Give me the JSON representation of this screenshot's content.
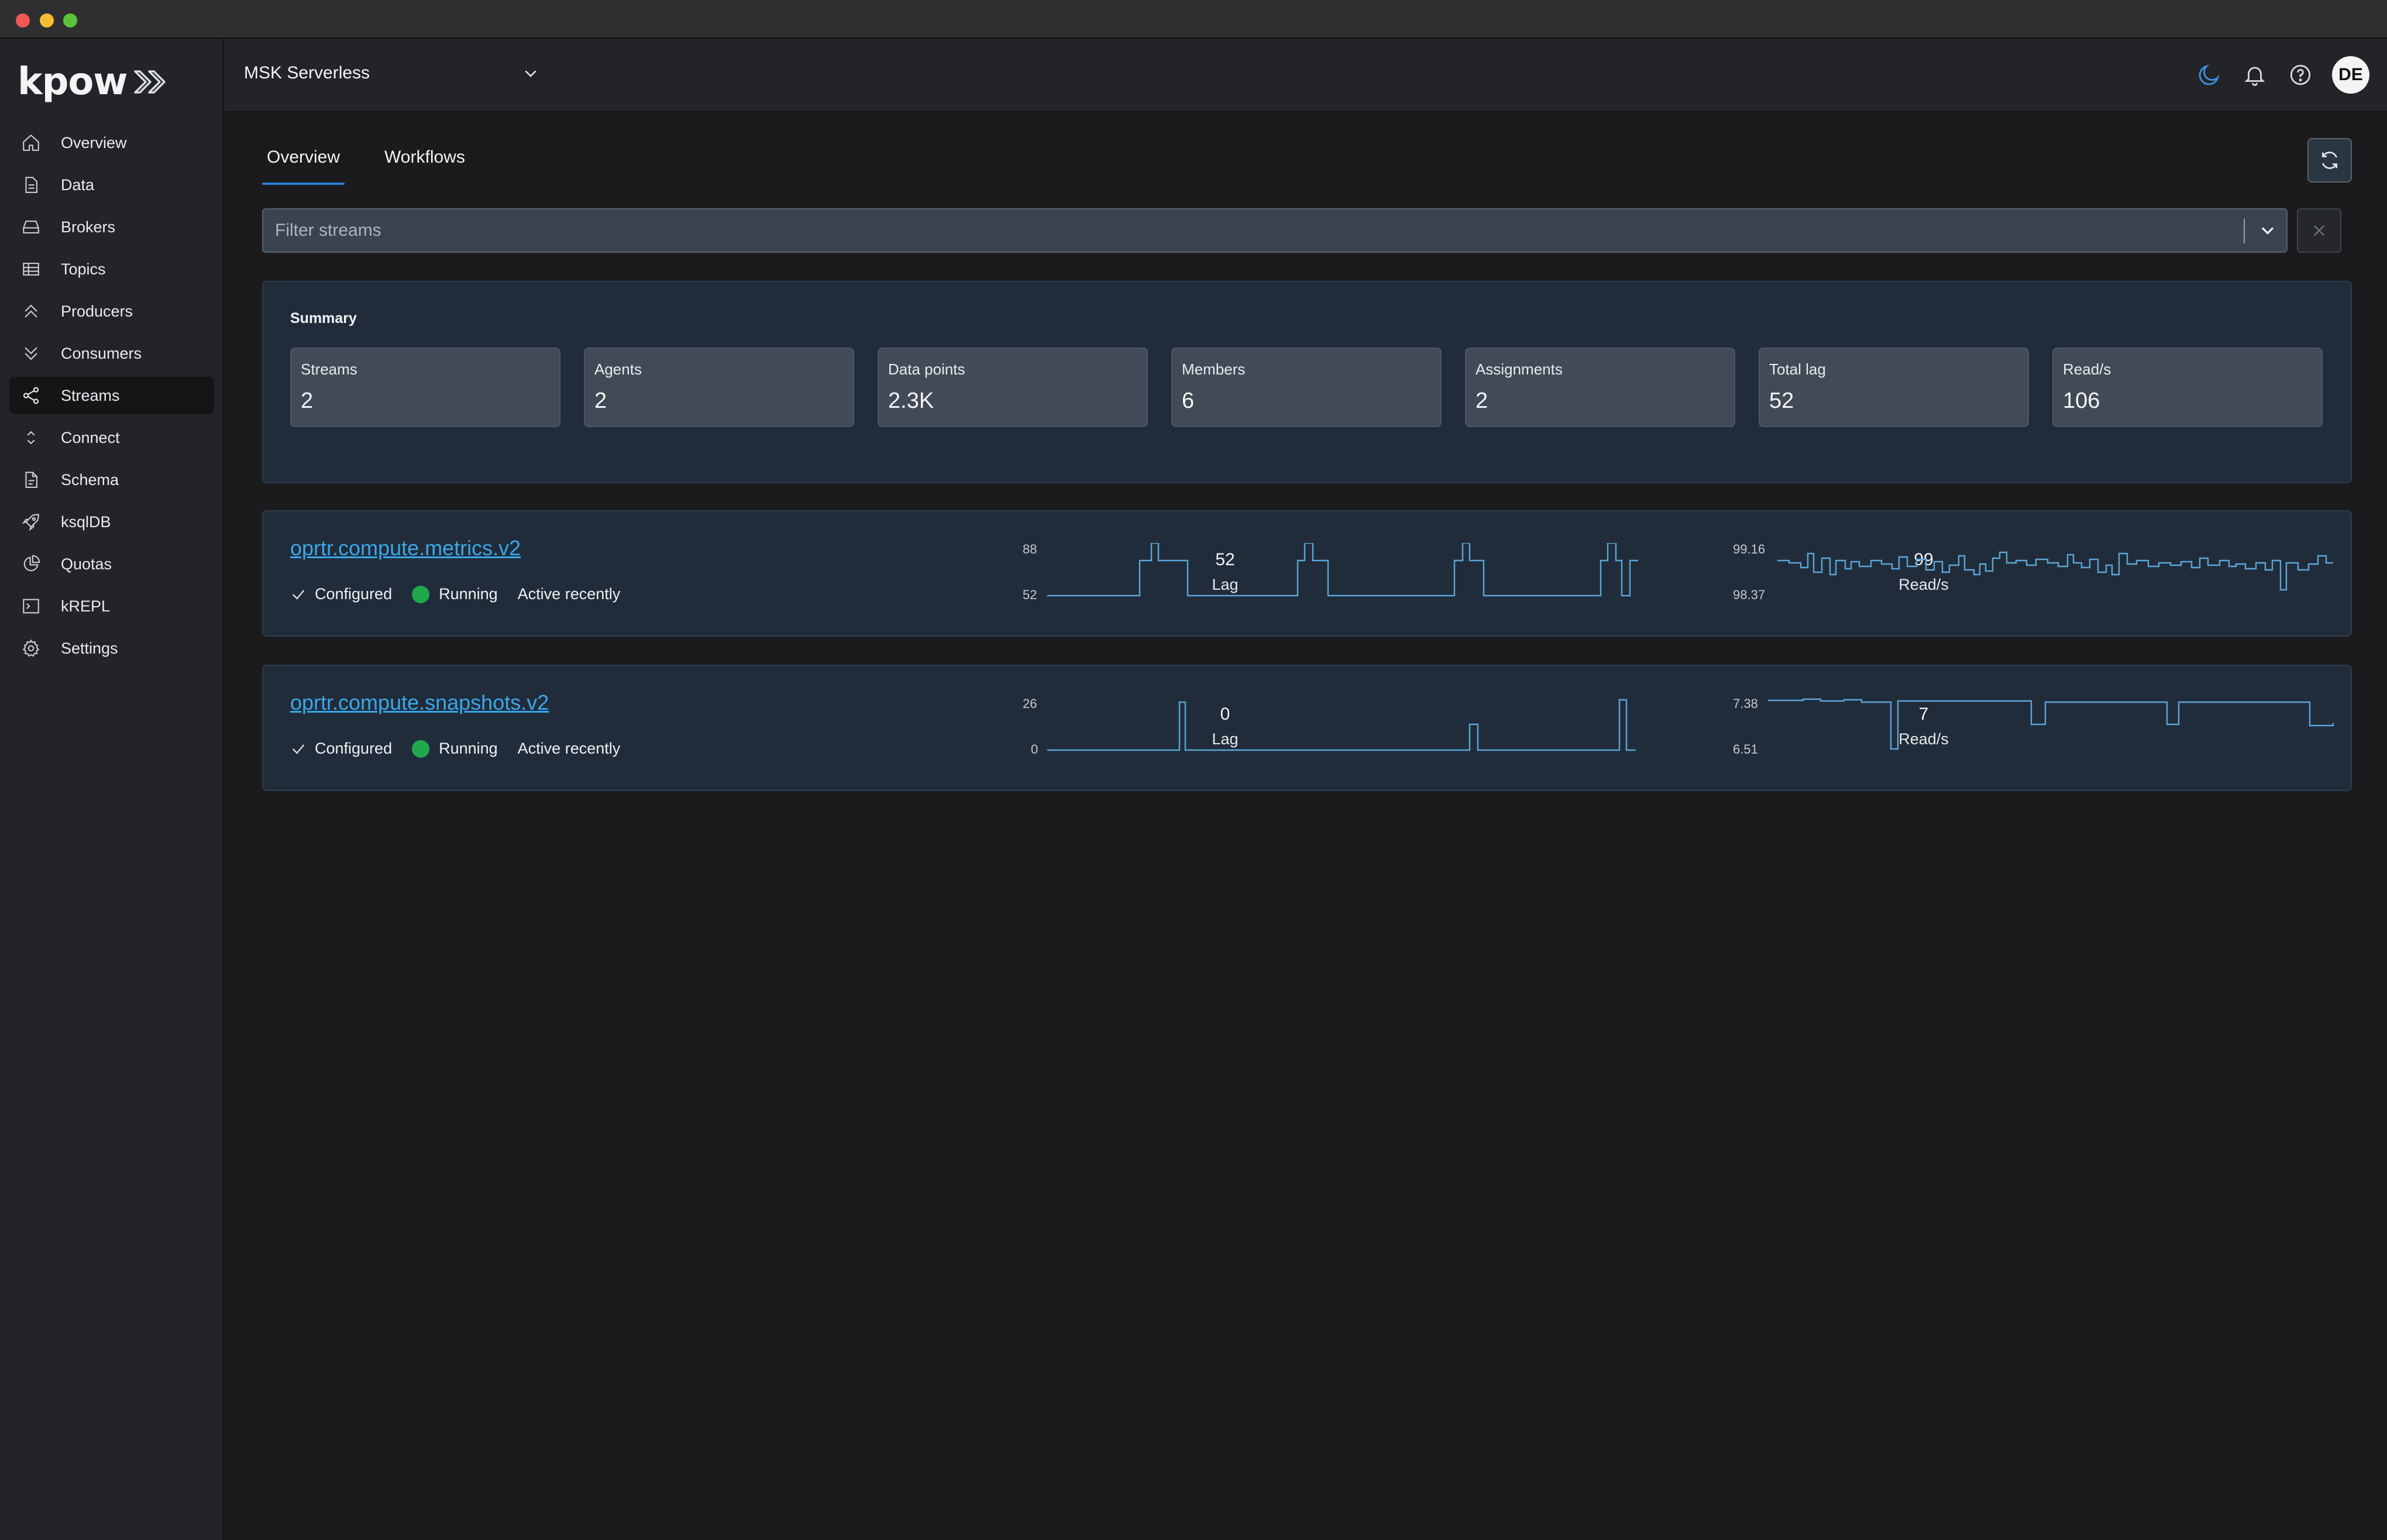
{
  "app": {
    "logo_text": "kpow"
  },
  "sidebar": {
    "items": [
      {
        "label": "Overview",
        "icon": "home-icon"
      },
      {
        "label": "Data",
        "icon": "document-icon"
      },
      {
        "label": "Brokers",
        "icon": "server-icon"
      },
      {
        "label": "Topics",
        "icon": "table-icon"
      },
      {
        "label": "Producers",
        "icon": "chevrons-up-icon"
      },
      {
        "label": "Consumers",
        "icon": "chevrons-down-icon"
      },
      {
        "label": "Streams",
        "icon": "share-icon",
        "active": true
      },
      {
        "label": "Connect",
        "icon": "up-down-icon"
      },
      {
        "label": "Schema",
        "icon": "file-icon"
      },
      {
        "label": "ksqlDB",
        "icon": "rocket-icon"
      },
      {
        "label": "Quotas",
        "icon": "pie-chart-icon"
      },
      {
        "label": "kREPL",
        "icon": "terminal-icon"
      },
      {
        "label": "Settings",
        "icon": "gear-icon"
      }
    ]
  },
  "header": {
    "environment": "MSK Serverless",
    "user_initials": "DE"
  },
  "tabs": [
    {
      "label": "Overview",
      "active": true
    },
    {
      "label": "Workflows",
      "active": false
    }
  ],
  "filter": {
    "placeholder": "Filter streams",
    "value": ""
  },
  "summary": {
    "title": "Summary",
    "stats": [
      {
        "label": "Streams",
        "value": "2"
      },
      {
        "label": "Agents",
        "value": "2"
      },
      {
        "label": "Data points",
        "value": "2.3K"
      },
      {
        "label": "Members",
        "value": "6"
      },
      {
        "label": "Assignments",
        "value": "2"
      },
      {
        "label": "Total lag",
        "value": "52"
      },
      {
        "label": "Read/s",
        "value": "106"
      }
    ]
  },
  "streams": [
    {
      "name": "oprtr.compute.metrics.v2",
      "status": {
        "configured": "Configured",
        "running": "Running",
        "activity": "Active recently"
      },
      "lag": {
        "value": "52",
        "label": "Lag",
        "max": "88",
        "min": "52"
      },
      "reads": {
        "value": "99",
        "label": "Read/s",
        "max": "99.16",
        "min": "98.37"
      }
    },
    {
      "name": "oprtr.compute.snapshots.v2",
      "status": {
        "configured": "Configured",
        "running": "Running",
        "activity": "Active recently"
      },
      "lag": {
        "value": "0",
        "label": "Lag",
        "max": "26",
        "min": "0"
      },
      "reads": {
        "value": "7",
        "label": "Read/s",
        "max": "7.38",
        "min": "6.51"
      }
    }
  ],
  "colors": {
    "accent": "#2e7dd8",
    "link": "#39a7e8",
    "running": "#1fa84d",
    "sparkline": "#5aa6d8"
  }
}
